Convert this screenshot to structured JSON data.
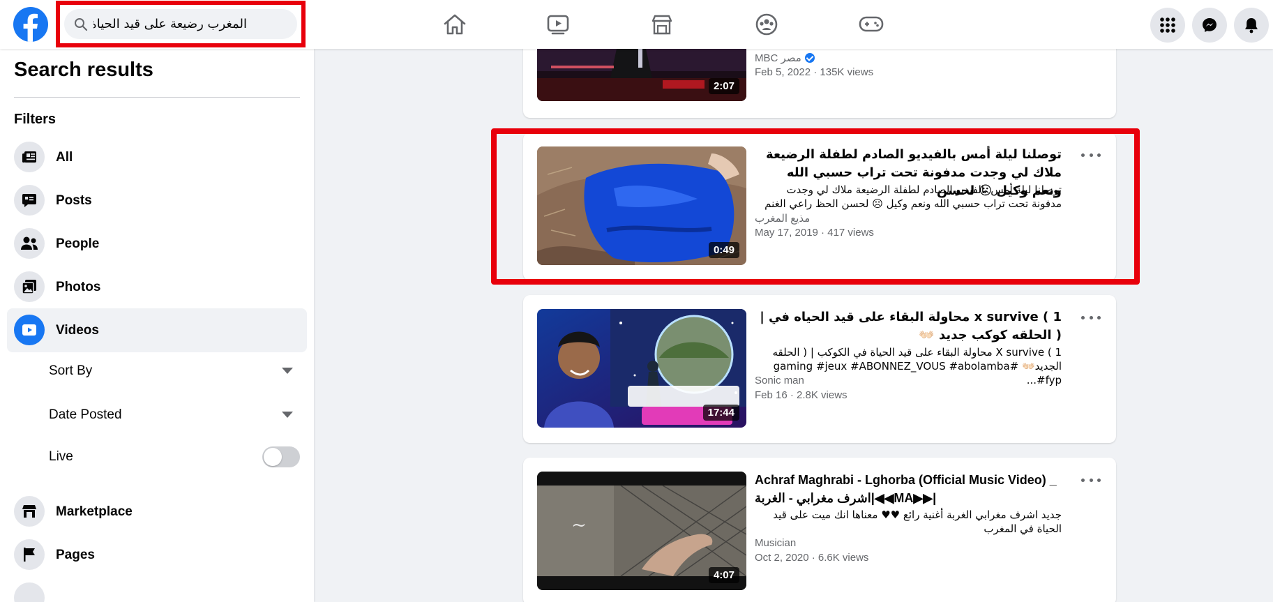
{
  "search": {
    "query": "المغرب رضيعة على قيد الحياة"
  },
  "sidebar": {
    "title": "Search results",
    "filters_label": "Filters",
    "items": [
      {
        "label": "All",
        "icon": "feed-icon",
        "active": false
      },
      {
        "label": "Posts",
        "icon": "post-icon",
        "active": false
      },
      {
        "label": "People",
        "icon": "people-icon",
        "active": false
      },
      {
        "label": "Photos",
        "icon": "photos-icon",
        "active": false
      },
      {
        "label": "Videos",
        "icon": "video-icon",
        "active": true
      },
      {
        "label": "Marketplace",
        "icon": "marketplace-icon",
        "active": false
      },
      {
        "label": "Pages",
        "icon": "flag-icon",
        "active": false
      }
    ],
    "video_filters": [
      {
        "label": "Sort By"
      },
      {
        "label": "Date Posted"
      },
      {
        "label": "Live",
        "enabled": false
      }
    ]
  },
  "results": [
    {
      "title": "",
      "description": "",
      "author": "MBC مصر",
      "verified": true,
      "meta": "Feb 5, 2022 · 135K views",
      "duration": "2:07"
    },
    {
      "title": "توصلنا ليلة أمس بالفيديو الصادم لطفلة الرضيعة ملاك لي وجدت مدفونة تحت تراب حسبي الله ونعم وكيل ☹ لحسن",
      "description": "توصلنا ليلة أمس بالفيديو الصادم لطفلة الرضيعة ملاك لي وجدت مدفونة تحت تراب حسبي الله ونعم وكيل ☹ لحسن الحظ راعي الغنم",
      "author": "مذيع المغرب",
      "meta": "May 17, 2019 · 417 views",
      "duration": "0:49"
    },
    {
      "title": "x survive ( 1 محاولة البقاء على قيد الحياه في | ( الحلقه كوكب جديد 👐🏻",
      "description": "X survive ( 1 محاولة البقاء على قيد الحياة في الكوكب | ( الحلقه الجديد👐🏻 #gaming #jeux #ABONNEZ_VOUS #abolamba #fyp...",
      "author": "Sonic man",
      "meta": "Feb 16 · 2.8K views",
      "duration": "17:44"
    },
    {
      "title": "Achraf Maghrabi - Lghorba (Official Music Video) _ اشرف مغرابي - الغربة|◀◀MA▶▶|",
      "description": "جديد اشرف مغرابي الغربة أغنية رائع ♥♥ معناها انك ميت على قيد الحياة في المغرب",
      "author": "Musician",
      "meta": "Oct 2, 2020 · 6.6K views",
      "duration": "4:07"
    }
  ],
  "colors": {
    "brand": "#1877f2",
    "highlight": "#e8000b",
    "background": "#f0f2f5"
  }
}
